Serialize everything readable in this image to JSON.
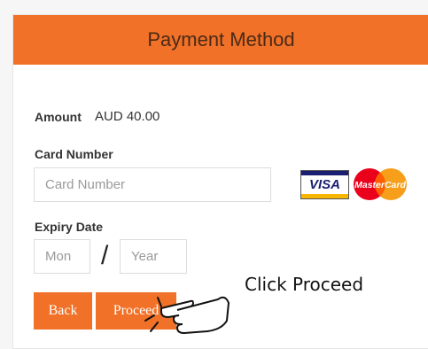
{
  "header": {
    "title": "Payment Method"
  },
  "amount": {
    "label": "Amount",
    "value": "AUD 40.00"
  },
  "card_number": {
    "label": "Card Number",
    "placeholder": "Card Number"
  },
  "card_logos": {
    "visa": "VISA",
    "mastercard": "MasterCard"
  },
  "expiry": {
    "label": "Expiry Date",
    "month_placeholder": "Mon",
    "separator": "/",
    "year_placeholder": "Year"
  },
  "buttons": {
    "back": "Back",
    "proceed": "Proceed"
  },
  "annotation": {
    "text": "Click Proceed"
  },
  "colors": {
    "accent": "#f07127",
    "visa_blue": "#1a1f71",
    "visa_gold": "#f7b600",
    "mc_red": "#eb001b",
    "mc_orange": "#f79e1b"
  }
}
